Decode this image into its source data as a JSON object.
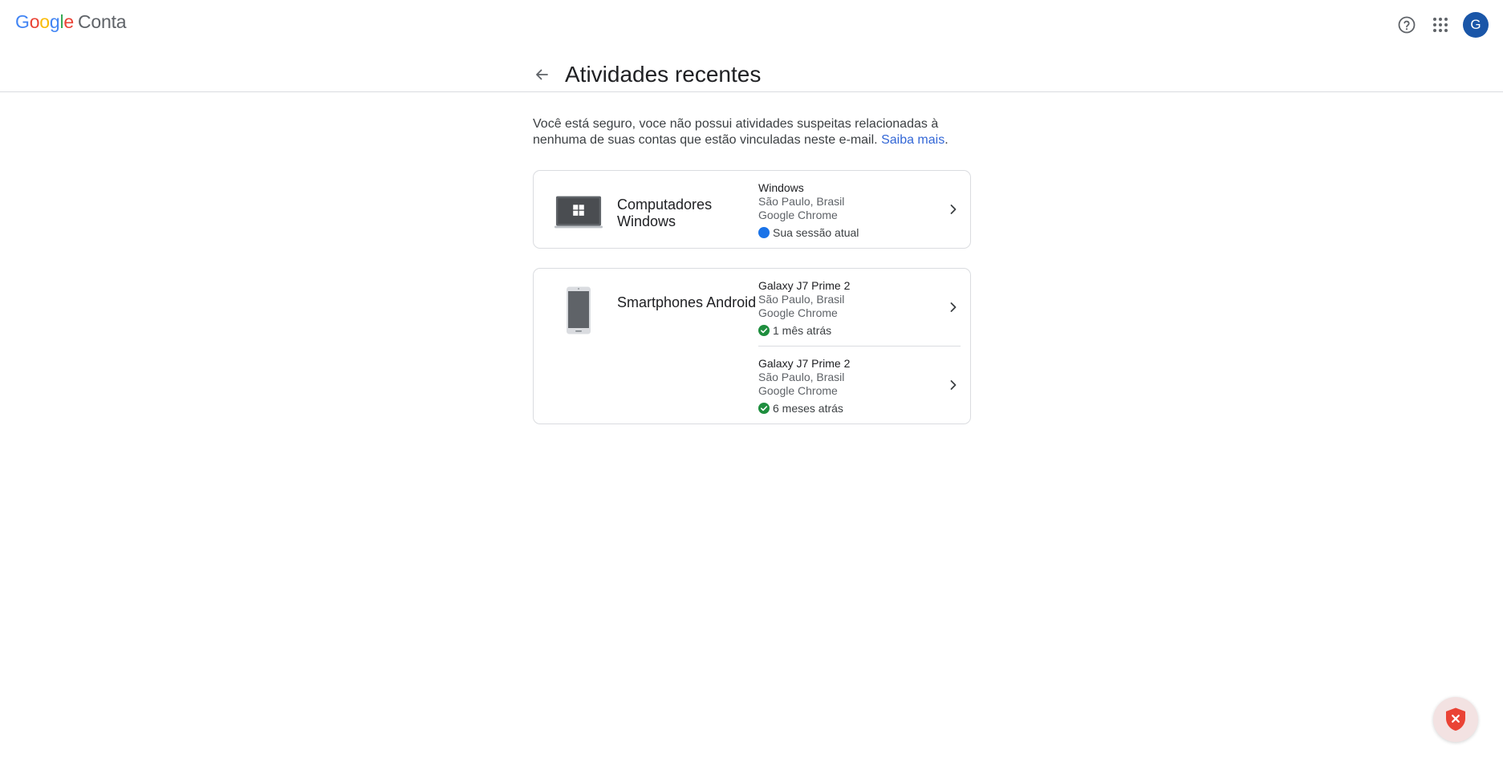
{
  "header": {
    "logo_letters": [
      "G",
      "o",
      "o",
      "g",
      "l",
      "e"
    ],
    "logo_colors": [
      "#4285F4",
      "#EA4335",
      "#FBBC05",
      "#4285F4",
      "#34A853",
      "#EA4335"
    ],
    "product_name": "Conta",
    "help_icon": "help-circle-icon",
    "apps_icon": "apps-grid-icon",
    "avatar_letter": "G"
  },
  "page": {
    "back_icon": "arrow-left-icon",
    "title": "Atividades recentes"
  },
  "intro": {
    "text": "Você está seguro, voce não possui atividades suspeitas relacionadas à nenhuma de suas contas que estão vinculadas neste e-mail.",
    "link_label": "Saiba mais",
    "trailing": "."
  },
  "device_groups": [
    {
      "device_type": "Computadores Windows",
      "icon": "windows-laptop-icon",
      "sessions": [
        {
          "device_name": "Windows",
          "location": "São Paulo, Brasil",
          "browser": "Google Chrome",
          "status": "Sua sessão atual",
          "status_icon": "current-session-dot-icon",
          "status_color": "#1a73e8"
        }
      ]
    },
    {
      "device_type": "Smartphones Android",
      "icon": "android-phone-icon",
      "sessions": [
        {
          "device_name": "Galaxy J7 Prime 2",
          "location": "São Paulo, Brasil",
          "browser": "Google Chrome",
          "status": "1 mês atrás",
          "status_icon": "check-circle-icon",
          "status_color": "#1e8e3e"
        },
        {
          "device_name": "Galaxy J7 Prime 2",
          "location": "São Paulo, Brasil",
          "browser": "Google Chrome",
          "status": "6 meses atrás",
          "status_icon": "check-circle-icon",
          "status_color": "#1e8e3e"
        }
      ]
    }
  ],
  "floating_button": {
    "icon": "shield-x-icon",
    "color": "#ea4335"
  },
  "colors": {
    "accent": "#1a73e8",
    "avatar_bg": "#1a56a8",
    "border": "#dadce0"
  }
}
